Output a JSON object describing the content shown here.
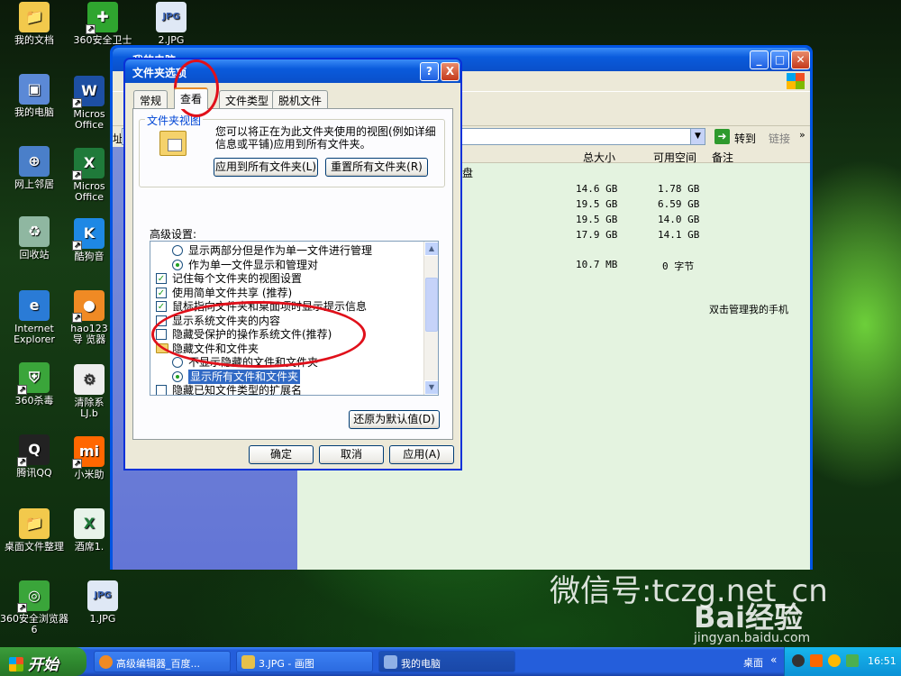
{
  "desktop": {
    "icons": [
      {
        "label": "我的文档",
        "icon": "my-documents-icon"
      },
      {
        "label": "360安全卫士",
        "icon": "360-safe-icon"
      },
      {
        "label": "2.JPG",
        "icon": "jpg-file-icon"
      },
      {
        "label": "我的电脑",
        "icon": "my-computer-icon"
      },
      {
        "label": "Micros Office",
        "icon": "word-icon"
      },
      {
        "label": "网上邻居",
        "icon": "network-icon"
      },
      {
        "label": "Micros Office",
        "icon": "excel-icon"
      },
      {
        "label": "回收站",
        "icon": "recycle-bin-icon"
      },
      {
        "label": "酷狗音",
        "icon": "kugou-icon"
      },
      {
        "label": "Internet Explorer",
        "icon": "ie-icon"
      },
      {
        "label": "hao123导 览器",
        "icon": "hao123-icon"
      },
      {
        "label": "360杀毒",
        "icon": "360-antivirus-icon"
      },
      {
        "label": "清除系 LJ.b",
        "icon": "bat-file-icon"
      },
      {
        "label": "腾讯QQ",
        "icon": "qq-icon"
      },
      {
        "label": "小米助",
        "icon": "mi-icon"
      },
      {
        "label": "桌面文件整理",
        "icon": "folder-icon"
      },
      {
        "label": "酒席1.",
        "icon": "excel-file-icon"
      },
      {
        "label": "360安全浏览器6",
        "icon": "360-browser-icon"
      },
      {
        "label": "1.JPG",
        "icon": "jpg-file-icon"
      }
    ]
  },
  "explorer": {
    "title": "我的电脑",
    "address_prefix": "址",
    "go_label": "转到",
    "links_label": "链接",
    "columns": [
      "总大小",
      "可用空间",
      "备注"
    ],
    "drive_group": "盘",
    "drives": [
      {
        "total": "14.6 GB",
        "free": "1.78 GB"
      },
      {
        "total": "19.5 GB",
        "free": "6.59 GB"
      },
      {
        "total": "19.5 GB",
        "free": "14.0 GB"
      },
      {
        "total": "17.9 GB",
        "free": "14.1 GB"
      },
      {
        "total": "10.7 MB",
        "free": "0 字节"
      }
    ],
    "phone_label": "双击管理我的手机"
  },
  "dialog": {
    "title": "文件夹选项",
    "help_label": "?",
    "close_label": "X",
    "tabs": [
      "常规",
      "查看",
      "文件类型",
      "脱机文件"
    ],
    "group_title": "文件夹视图",
    "group_desc": "您可以将正在为此文件夹使用的视图(例如详细信息或平铺)应用到所有文件夹。",
    "apply_all_label": "应用到所有文件夹(L)",
    "reset_all_label": "重置所有文件夹(R)",
    "advanced_label": "高级设置:",
    "tree_items": [
      {
        "type": "radio",
        "checked": false,
        "indent": 1,
        "text": "显示两部分但是作为单一文件进行管理"
      },
      {
        "type": "radio",
        "checked": true,
        "indent": 1,
        "text": "作为单一文件显示和管理对"
      },
      {
        "type": "check",
        "checked": true,
        "indent": 0,
        "text": "记住每个文件夹的视图设置"
      },
      {
        "type": "check",
        "checked": true,
        "indent": 0,
        "text": "使用简单文件共享 (推荐)"
      },
      {
        "type": "check",
        "checked": true,
        "indent": 0,
        "text": "鼠标指向文件夹和桌面项时显示提示信息"
      },
      {
        "type": "check",
        "checked": false,
        "indent": 0,
        "text": "显示系统文件夹的内容"
      },
      {
        "type": "check",
        "checked": false,
        "indent": 0,
        "text": "隐藏受保护的操作系统文件(推荐)"
      },
      {
        "type": "folder",
        "checked": false,
        "indent": 0,
        "text": "隐藏文件和文件夹"
      },
      {
        "type": "radio",
        "checked": false,
        "indent": 1,
        "text": "不显示隐藏的文件和文件夹"
      },
      {
        "type": "radio",
        "checked": true,
        "indent": 1,
        "text": "显示所有文件和文件夹",
        "selected": true
      },
      {
        "type": "check",
        "checked": false,
        "indent": 0,
        "text": "隐藏已知文件类型的扩展名"
      }
    ],
    "restore_defaults_label": "还原为默认值(D)",
    "ok_label": "确定",
    "cancel_label": "取消",
    "apply_label": "应用(A)"
  },
  "taskbar": {
    "start_label": "开始",
    "tasks": [
      {
        "label": "高级编辑器_百度...",
        "icon": "firefox-icon"
      },
      {
        "label": "3.JPG - 画图",
        "icon": "paint-icon"
      },
      {
        "label": "我的电脑",
        "icon": "my-computer-icon"
      }
    ],
    "desktop_label": "桌面",
    "clock": "16:51"
  },
  "watermark": {
    "wechat": "微信号:tczg.net_cn",
    "baidu": "Bai经验",
    "site": "jingyan.baidu.com"
  }
}
